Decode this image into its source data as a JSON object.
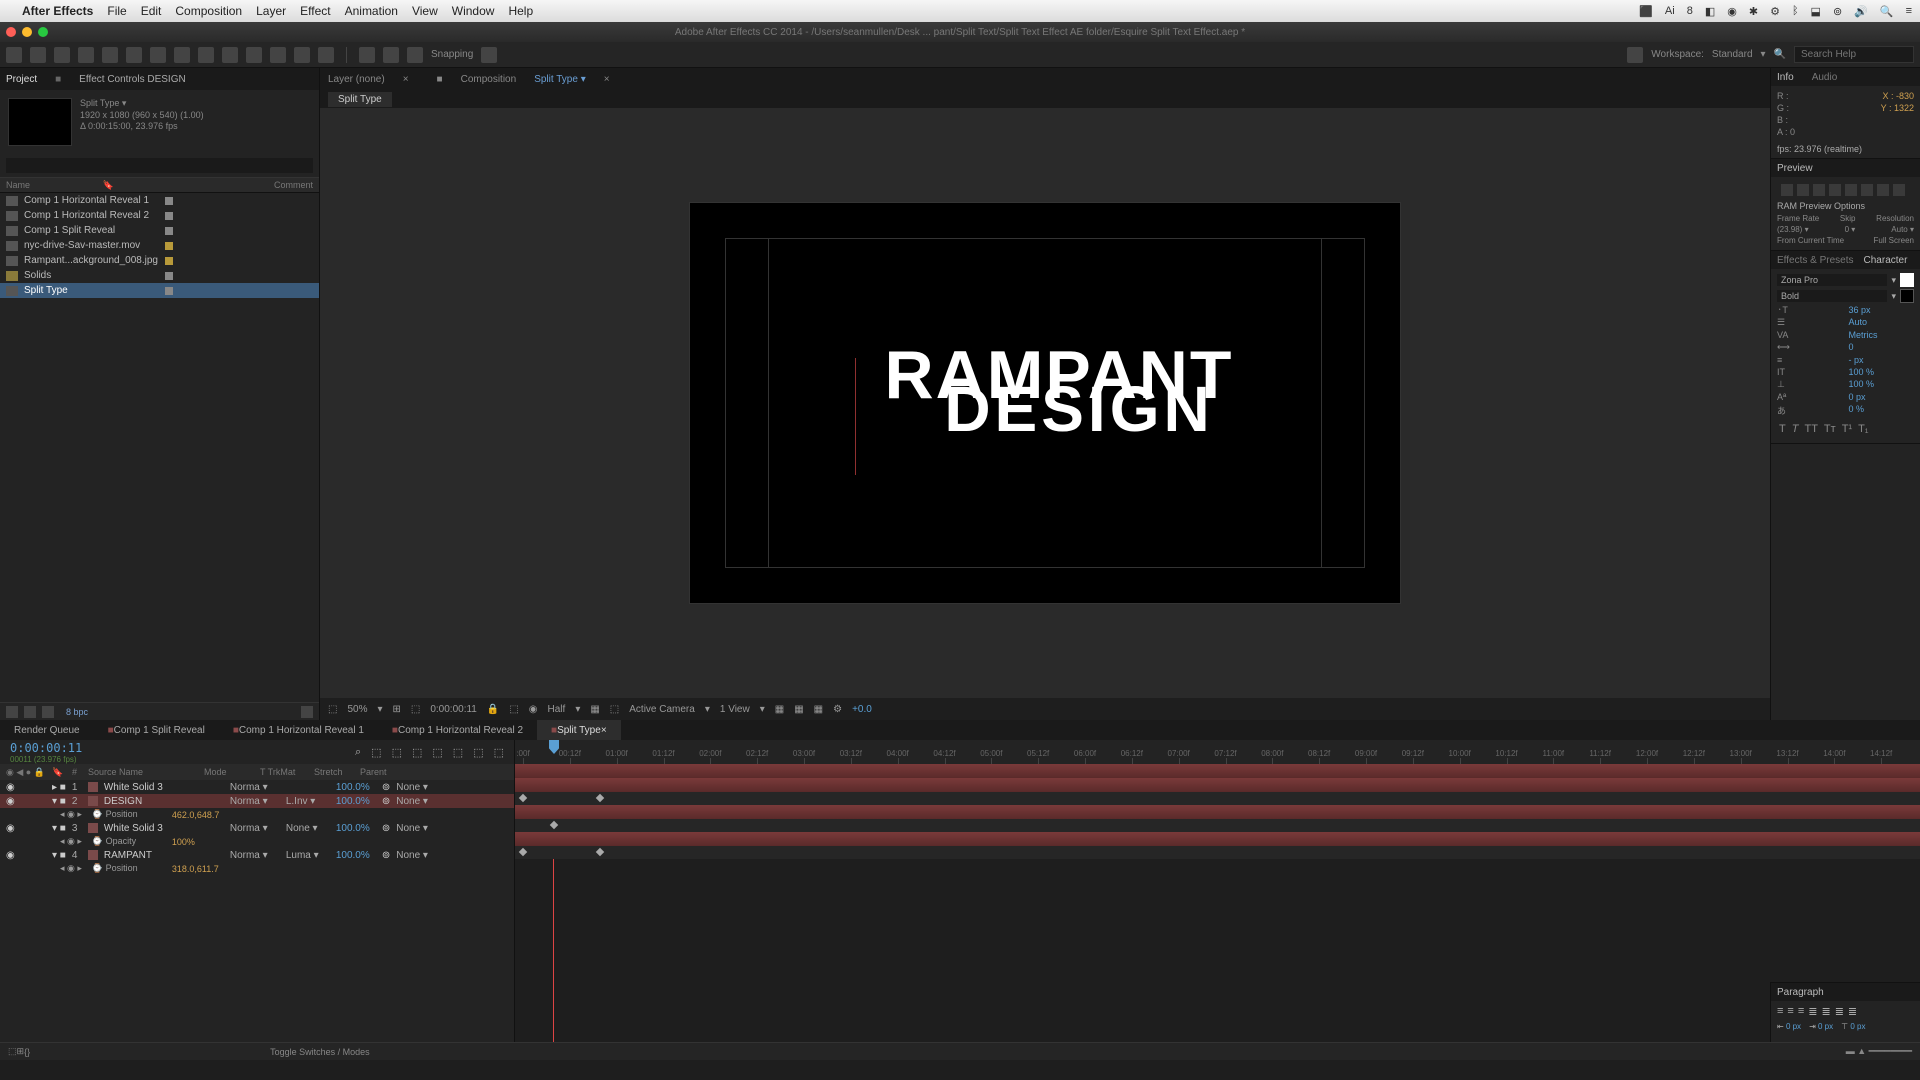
{
  "macbar": {
    "app": "After Effects",
    "menus": [
      "File",
      "Edit",
      "Composition",
      "Layer",
      "Effect",
      "Animation",
      "View",
      "Window",
      "Help"
    ]
  },
  "title": "Adobe After Effects CC 2014 - /Users/seanmullen/Desk ... pant/Split Text/Split Text Effect AE folder/Esquire Split Text Effect.aep *",
  "toolbar": {
    "snapping": "Snapping",
    "workspace_lbl": "Workspace:",
    "workspace_val": "Standard",
    "search_ph": "Search Help"
  },
  "project": {
    "tab1": "Project",
    "tab2": "Effect Controls DESIGN",
    "comp_name": "Split Type ▾",
    "meta1": "1920 x 1080 (960 x 540) (1.00)",
    "meta2": "Δ 0:00:15:00, 23.976 fps",
    "search_ph": "",
    "col_name": "Name",
    "col_comment": "Comment",
    "items": [
      {
        "name": "Comp 1 Horizontal Reveal 1",
        "type": "comp"
      },
      {
        "name": "Comp 1 Horizontal Reveal 2",
        "type": "comp"
      },
      {
        "name": "Comp 1 Split Reveal",
        "type": "comp"
      },
      {
        "name": "nyc-drive-Sav-master.mov",
        "type": "mov"
      },
      {
        "name": "Rampant...ackground_008.jpg",
        "type": "img"
      },
      {
        "name": "Solids",
        "type": "folder"
      },
      {
        "name": "Split Type",
        "type": "comp",
        "sel": true
      }
    ],
    "bpc": "8 bpc"
  },
  "comp": {
    "layer_lbl": "Layer (none)",
    "comp_lbl": "Composition",
    "comp_link": "Split Type ▾",
    "sub_tab": "Split Type",
    "text_top": "RAMPANT",
    "text_bot": "DESIGN"
  },
  "viewer_foot": {
    "zoom": "50%",
    "time": "0:00:00:11",
    "res": "Half",
    "camera": "Active Camera",
    "views": "1 View",
    "exp": "+0.0"
  },
  "info": {
    "tab1": "Info",
    "tab2": "Audio",
    "r": "R :",
    "g": "G :",
    "b": "B :",
    "a": "A : 0",
    "x": "X : -830",
    "y": "Y : 1322",
    "fps": "fps: 23.976 (realtime)"
  },
  "preview": {
    "tab": "Preview",
    "ram": "RAM Preview Options",
    "h1": "Frame Rate",
    "h2": "Skip",
    "h3": "Resolution",
    "v1": "(23.98) ▾",
    "v2": "0 ▾",
    "v3": "Auto ▾",
    "fct": "From Current Time",
    "fs": "Full Screen"
  },
  "char": {
    "tab1": "Effects & Presets",
    "tab2": "Character",
    "font": "Zona Pro",
    "weight": "Bold",
    "sz": "36 px",
    "lead": "Auto",
    "kern": "Metrics",
    "track": "0",
    "vsc": "- px",
    "scale": "100 %",
    "scale2": "100 %",
    "base": "0 px",
    "tsume": "0 %"
  },
  "timeline": {
    "tabs": [
      "Render Queue",
      "Comp 1 Split Reveal",
      "Comp 1 Horizontal Reveal 1",
      "Comp 1 Horizontal Reveal 2",
      "Split Type"
    ],
    "active_tab": 4,
    "timecode": "0:00:00:11",
    "timecode_sub": "00011 (23.976 fps)",
    "cols": {
      "num": "#",
      "source": "Source Name",
      "mode": "Mode",
      "trk": "T TrkMat",
      "stretch": "Stretch",
      "parent": "Parent"
    },
    "layers": [
      {
        "n": "1",
        "name": "White Solid 3",
        "mode": "Norma ▾",
        "trk": "",
        "pct": "100.0%",
        "par": "None ▾"
      },
      {
        "n": "2",
        "name": "DESIGN",
        "mode": "Norma ▾",
        "trk": "L.Inv ▾",
        "pct": "100.0%",
        "par": "None ▾",
        "sel": true,
        "sub": {
          "prop": "Position",
          "val": "462.0,648.7"
        }
      },
      {
        "n": "3",
        "name": "White Solid 3",
        "mode": "Norma ▾",
        "trk": "None ▾",
        "pct": "100.0%",
        "par": "None ▾",
        "sub": {
          "prop": "Opacity",
          "val": "100%"
        }
      },
      {
        "n": "4",
        "name": "RAMPANT",
        "mode": "Norma ▾",
        "trk": "Luma ▾",
        "pct": "100.0%",
        "par": "None ▾",
        "sub": {
          "prop": "Position",
          "val": "318.0,611.7"
        }
      }
    ],
    "ruler": [
      ":00f",
      "00:12f",
      "01:00f",
      "01:12f",
      "02:00f",
      "02:12f",
      "03:00f",
      "03:12f",
      "04:00f",
      "04:12f",
      "05:00f",
      "05:12f",
      "06:00f",
      "06:12f",
      "07:00f",
      "07:12f",
      "08:00f",
      "08:12f",
      "09:00f",
      "09:12f",
      "10:00f",
      "10:12f",
      "11:00f",
      "11:12f",
      "12:00f",
      "12:12f",
      "13:00f",
      "13:12f",
      "14:00f",
      "14:12f"
    ],
    "toggle": "Toggle Switches / Modes"
  },
  "paragraph": {
    "tab": "Paragraph",
    "px": "0 px"
  }
}
